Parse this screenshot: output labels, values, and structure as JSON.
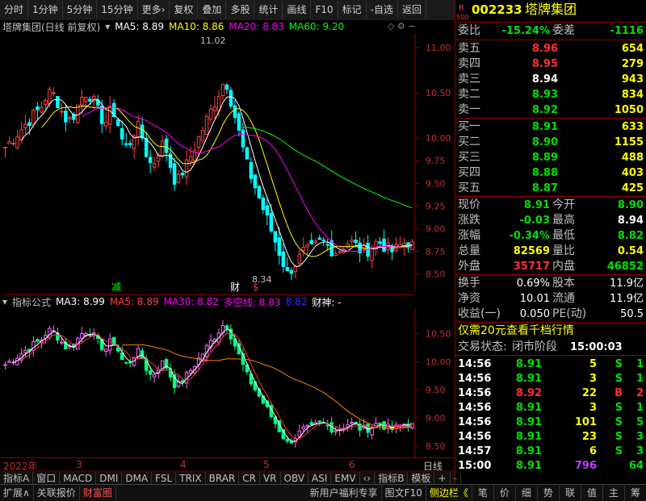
{
  "toolbar": {
    "items": [
      "分时",
      "1分钟",
      "5分钟",
      "15分钟",
      "更多",
      "复权",
      "叠加",
      "多股",
      "统计",
      "画线",
      "F10",
      "标记",
      "-自选",
      "返回"
    ],
    "more_arrow": "›"
  },
  "main_legend": {
    "title": "塔牌集团(日线 前复权)",
    "ma5": "MA5: 8.89",
    "ma10": "MA10: 8.86",
    "ma20": "MA20: 8.83",
    "ma60": "MA60: 9.20",
    "colors": {
      "ma5": "#ffffff",
      "ma10": "#ffff00",
      "ma20": "#ff00ff",
      "ma60": "#00ff00"
    }
  },
  "main_chart": {
    "y_ticks": [
      "11.00",
      "10.50",
      "10.00",
      "9.75",
      "9.50",
      "9.25",
      "9.00",
      "8.75",
      "8.50"
    ],
    "high_label": "11.02",
    "low_label": "8.34",
    "mark_jian": "减",
    "mark_cai": "财",
    "mark_s": "$"
  },
  "sub_legend": {
    "title": "指标公式",
    "ma3": "MA3: 8.99",
    "ma5": "MA5: 8.89",
    "ma30": "MA30: 8.82",
    "duokong": "多空线: 8.83",
    "blue_val": "8.82",
    "caishen": "财神: -"
  },
  "sub_chart": {
    "y_ticks": [
      "10.50",
      "10.00",
      "9.50",
      "9.00",
      "8.50"
    ]
  },
  "time_axis": {
    "labels": [
      "2022年",
      "3",
      "4",
      "5",
      "6"
    ],
    "right_label": "日线"
  },
  "index_bar": {
    "left": "指标A",
    "items": [
      "窗口",
      "MACD",
      "DMI",
      "DMA",
      "FSL",
      "TRIX",
      "BRAR",
      "CR",
      "VR",
      "OBV",
      "ASI",
      "EMV"
    ],
    "right": [
      "指标B",
      "模板",
      "+",
      "-"
    ]
  },
  "status_bar": {
    "items": [
      "扩展∧",
      "关联报价",
      "财富圈"
    ],
    "right": [
      "新用户福利专享",
      "图文F10",
      "侧边栏《"
    ],
    "icons": [
      "笔",
      "价",
      "细",
      "势",
      "联",
      "值",
      "主",
      "筹"
    ]
  },
  "quote": {
    "code": "002233",
    "name": "塔牌集团",
    "r_label": "R",
    "r_sub": "500",
    "weibi_label": "委比",
    "weibi": "-15.24%",
    "weicha_label": "委差",
    "weicha": "-1116",
    "asks": [
      {
        "label": "卖五",
        "price": "8.96",
        "vol": "654"
      },
      {
        "label": "卖四",
        "price": "8.95",
        "vol": "279"
      },
      {
        "label": "卖三",
        "price": "8.94",
        "vol": "943"
      },
      {
        "label": "卖二",
        "price": "8.93",
        "vol": "834"
      },
      {
        "label": "卖一",
        "price": "8.92",
        "vol": "1050"
      }
    ],
    "bids": [
      {
        "label": "买一",
        "price": "8.91",
        "vol": "633"
      },
      {
        "label": "买二",
        "price": "8.90",
        "vol": "1155"
      },
      {
        "label": "买三",
        "price": "8.89",
        "vol": "488"
      },
      {
        "label": "买四",
        "price": "8.88",
        "vol": "403"
      },
      {
        "label": "买五",
        "price": "8.87",
        "vol": "425"
      }
    ],
    "stats": [
      {
        "l1": "现价",
        "v1": "8.91",
        "c1": "#00e000",
        "l2": "今开",
        "v2": "8.90",
        "c2": "#00e000"
      },
      {
        "l1": "涨跌",
        "v1": "-0.03",
        "c1": "#00e000",
        "l2": "最高",
        "v2": "8.94",
        "c2": "#ffffff"
      },
      {
        "l1": "涨幅",
        "v1": "-0.34%",
        "c1": "#00e000",
        "l2": "最低",
        "v2": "8.82",
        "c2": "#00e000"
      },
      {
        "l1": "总量",
        "v1": "82569",
        "c1": "#ffff00",
        "l2": "量比",
        "v2": "0.54",
        "c2": "#ffff00"
      },
      {
        "l1": "外盘",
        "v1": "35717",
        "c1": "#ff3030",
        "l2": "内盘",
        "v2": "46852",
        "c2": "#00e000"
      }
    ],
    "fin": [
      {
        "l1": "换手",
        "v1": "0.69%",
        "l2": "股本",
        "v2": "11.9亿"
      },
      {
        "l1": "净资",
        "v1": "10.01",
        "l2": "流通",
        "v2": "11.9亿"
      },
      {
        "l1": "收益(一)",
        "v1": "0.050",
        "l2": "PE(动)",
        "v2": "50.5"
      }
    ],
    "promo": "仅需20元查看千档行情",
    "trade_state_label": "交易状态:",
    "trade_state": "闭市阶段",
    "trade_time": "15:00:03",
    "ticks": [
      {
        "t": "14:56",
        "p": "8.91",
        "v": "5",
        "f": "S",
        "n": "1"
      },
      {
        "t": "14:56",
        "p": "8.91",
        "v": "3",
        "f": "S",
        "n": "1"
      },
      {
        "t": "14:56",
        "p": "8.92",
        "v": "22",
        "f": "B",
        "n": "2"
      },
      {
        "t": "14:56",
        "p": "8.91",
        "v": "3",
        "f": "S",
        "n": "1"
      },
      {
        "t": "14:56",
        "p": "8.91",
        "v": "101",
        "f": "S",
        "n": "5"
      },
      {
        "t": "14:56",
        "p": "8.91",
        "v": "23",
        "f": "S",
        "n": "3"
      },
      {
        "t": "14:57",
        "p": "8.91",
        "v": "6",
        "f": "S",
        "n": "3"
      },
      {
        "t": "15:00",
        "p": "8.91",
        "v": "796",
        "f": "",
        "n": "64"
      }
    ]
  }
}
